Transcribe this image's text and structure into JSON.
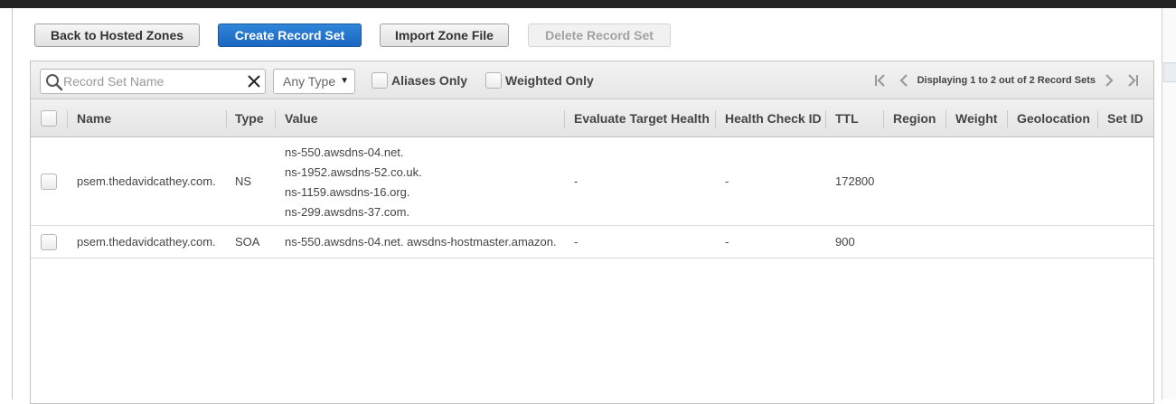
{
  "toolbar": {
    "back_label": "Back to Hosted Zones",
    "create_label": "Create Record Set",
    "import_label": "Import Zone File",
    "delete_label": "Delete Record Set"
  },
  "filter": {
    "search_placeholder": "Record Set Name",
    "search_value": "",
    "type_selected": "Any Type",
    "aliases_only_label": "Aliases Only",
    "weighted_only_label": "Weighted Only"
  },
  "pager": {
    "text": "Displaying 1 to 2 out of 2 Record Sets"
  },
  "columns": {
    "name": "Name",
    "type": "Type",
    "value": "Value",
    "evaluate_target_health": "Evaluate Target Health",
    "health_check_id": "Health Check ID",
    "ttl": "TTL",
    "region": "Region",
    "weight": "Weight",
    "geolocation": "Geolocation",
    "set_id": "Set ID"
  },
  "rows": [
    {
      "name": "psem.thedavidcathey.com.",
      "type": "NS",
      "values": [
        "ns-550.awsdns-04.net.",
        "ns-1952.awsdns-52.co.uk.",
        "ns-1159.awsdns-16.org.",
        "ns-299.awsdns-37.com."
      ],
      "evaluate_target_health": "-",
      "health_check_id": "-",
      "ttl": "172800",
      "region": "",
      "weight": "",
      "geolocation": "",
      "set_id": ""
    },
    {
      "name": "psem.thedavidcathey.com.",
      "type": "SOA",
      "values": [
        "ns-550.awsdns-04.net. awsdns-hostmaster.amazon."
      ],
      "evaluate_target_health": "-",
      "health_check_id": "-",
      "ttl": "900",
      "region": "",
      "weight": "",
      "geolocation": "",
      "set_id": ""
    }
  ],
  "icons": {
    "search": "search-icon",
    "clear": "close-icon",
    "first_page": "first-page-icon",
    "prev_page": "previous-page-icon",
    "next_page": "next-page-icon",
    "last_page": "last-page-icon"
  },
  "colors": {
    "primary_button": "#1b66c1",
    "topbar": "#232323"
  }
}
